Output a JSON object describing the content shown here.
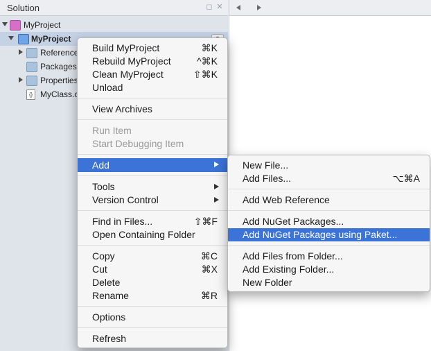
{
  "pad": {
    "title": "Solution",
    "tree": {
      "solution_label": "MyProject",
      "project_label": "MyProject",
      "references_label": "References",
      "packages_label": "Packages",
      "properties_label": "Properties",
      "file_label": "MyClass.cs"
    }
  },
  "context_menu": {
    "build_label": "Build MyProject",
    "build_sc": "⌘K",
    "rebuild_label": "Rebuild MyProject",
    "rebuild_sc": "^⌘K",
    "clean_label": "Clean MyProject",
    "clean_sc": "⇧⌘K",
    "unload_label": "Unload",
    "view_archives_label": "View Archives",
    "run_item_label": "Run Item",
    "start_debugging_label": "Start Debugging Item",
    "add_label": "Add",
    "tools_label": "Tools",
    "version_control_label": "Version Control",
    "find_in_files_label": "Find in Files...",
    "find_in_files_sc": "⇧⌘F",
    "open_folder_label": "Open Containing Folder",
    "copy_label": "Copy",
    "copy_sc": "⌘C",
    "cut_label": "Cut",
    "cut_sc": "⌘X",
    "delete_label": "Delete",
    "rename_label": "Rename",
    "rename_sc": "⌘R",
    "options_label": "Options",
    "refresh_label": "Refresh"
  },
  "add_submenu": {
    "new_file_label": "New File...",
    "add_files_label": "Add Files...",
    "add_files_sc": "⌥⌘A",
    "add_web_ref_label": "Add Web Reference",
    "add_nuget_label": "Add NuGet Packages...",
    "add_nuget_paket_label": "Add NuGet Packages using Paket...",
    "add_from_folder_label": "Add Files from Folder...",
    "add_existing_folder_label": "Add Existing Folder...",
    "new_folder_label": "New Folder"
  },
  "colors": {
    "highlight": "#3b73d6",
    "selection": "#c5d2e6"
  }
}
